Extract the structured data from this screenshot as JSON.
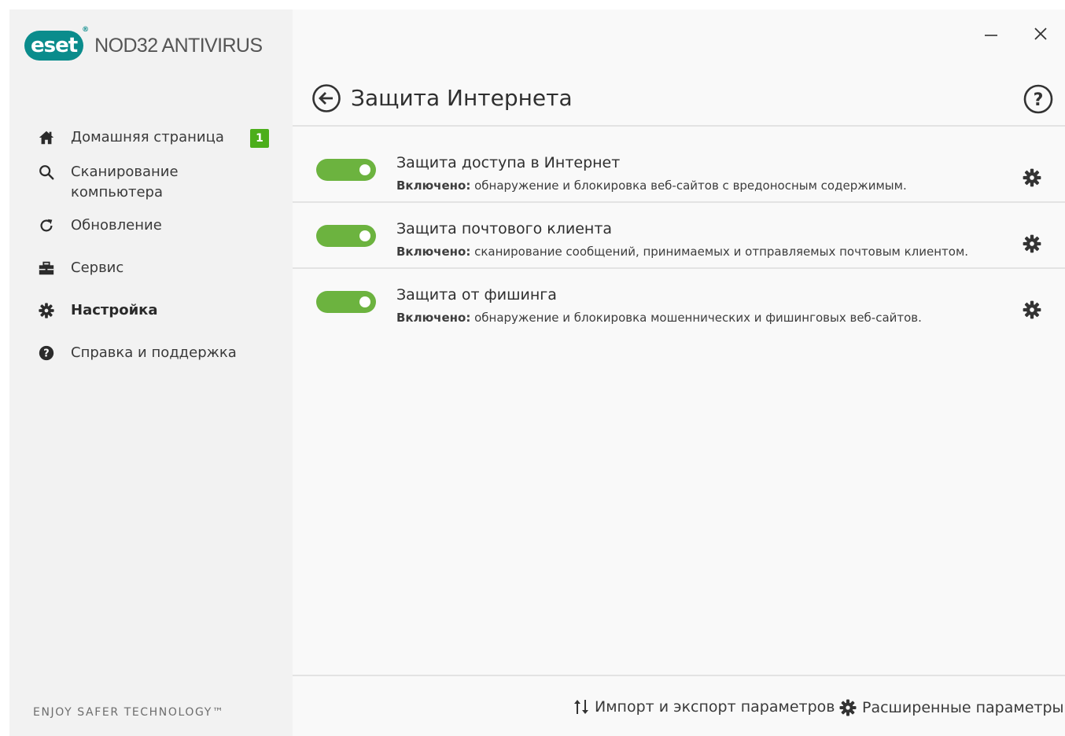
{
  "app": {
    "logo_text": "eset",
    "logo_reg": "®",
    "product_name": "NOD32 ANTIVIRUS",
    "slogan": "ENJOY SAFER TECHNOLOGY™",
    "brand_color": "#0a8c8c",
    "accent_green": "#6cb33f"
  },
  "sidebar": {
    "items": [
      {
        "label": "Домашняя страница",
        "icon": "home-icon",
        "badge": "1"
      },
      {
        "label": "Сканирование\nкомпьютера",
        "icon": "search-icon"
      },
      {
        "label": "Обновление",
        "icon": "refresh-icon"
      },
      {
        "label": "Сервис",
        "icon": "toolbox-icon"
      },
      {
        "label": "Настройка",
        "icon": "gear-icon",
        "active": true
      },
      {
        "label": "Справка и поддержка",
        "icon": "question-icon"
      }
    ]
  },
  "header": {
    "title": "Защита Интернета"
  },
  "features": [
    {
      "title": "Защита доступа в Интернет",
      "state": "Включено:",
      "description": " обнаружение и блокировка веб-сайтов с вредоносным содержимым.",
      "enabled": true
    },
    {
      "title": "Защита почтового клиента",
      "state": "Включено:",
      "description": " сканирование сообщений, принимаемых и отправляемых почтовым клиентом.",
      "enabled": true
    },
    {
      "title": "Защита от фишинга",
      "state": "Включено:",
      "description": " обнаружение и блокировка мошеннических и фишинговых веб-сайтов.",
      "enabled": true
    }
  ],
  "footer": {
    "import_export": "Импорт и экспорт параметров",
    "advanced": "Расширенные параметры"
  }
}
